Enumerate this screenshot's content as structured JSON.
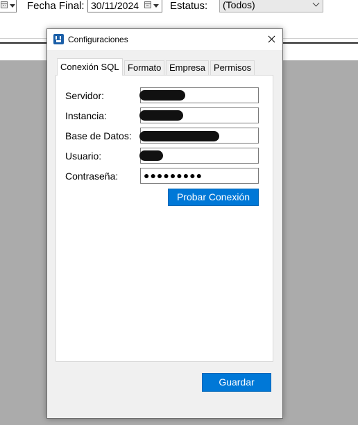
{
  "filters": {
    "fecha_final_label": "Fecha Final:",
    "fecha_final_value": "30/11/2024",
    "estatus_label": "Estatus:",
    "estatus_value": "(Todos)"
  },
  "dialog": {
    "title": "Configuraciones",
    "tabs": [
      {
        "label": "Conexión SQL",
        "active": true
      },
      {
        "label": "Formato",
        "active": false
      },
      {
        "label": "Empresa",
        "active": false
      },
      {
        "label": "Permisos",
        "active": false
      }
    ],
    "fields": {
      "servidor_label": "Servidor:",
      "instancia_label": "Instancia:",
      "base_datos_label": "Base de Datos:",
      "usuario_label": "Usuario:",
      "contrasena_label": "Contraseña:",
      "contrasena_value": "●●●●●●●●●"
    },
    "test_button": "Probar Conexión",
    "save_button": "Guardar"
  },
  "icons": {
    "dialog_icon": "app-icon",
    "close": "close-icon",
    "calendar": "calendar-icon",
    "dropdown": "chevron-down-icon"
  },
  "colors": {
    "accent": "#0078d7",
    "background_grey": "#ababab"
  }
}
